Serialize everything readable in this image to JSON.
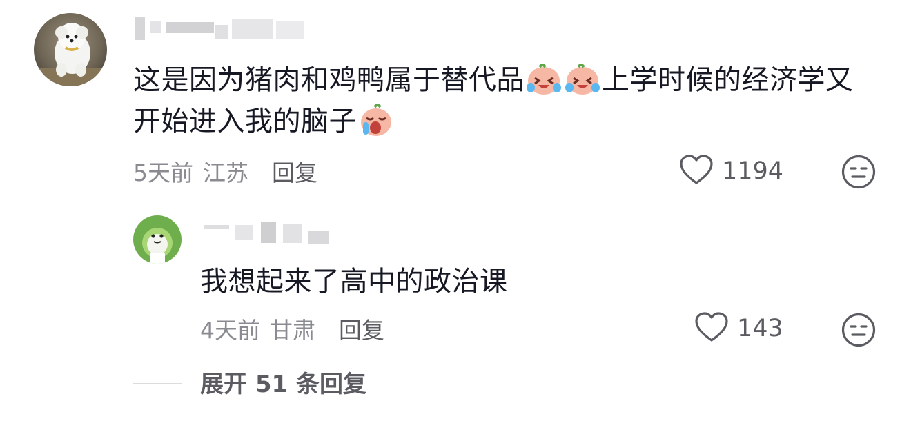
{
  "comment": {
    "text_part1": "这是因为猪肉和鸡鸭属于替代品",
    "text_part2": "上学时候的经济学又开始进入我的脑子",
    "time": "5天前",
    "location": "江苏",
    "reply_label": "回复",
    "like_count": "1194"
  },
  "sub_comment": {
    "text": "我想起来了高中的政治课",
    "time": "4天前",
    "location": "甘肃",
    "reply_label": "回复",
    "like_count": "143"
  },
  "expand": {
    "label": "展开 51 条回复"
  },
  "icons": {
    "heart": "heart-outline-icon",
    "dislike": "meh-face-icon",
    "emoji_laugh_cry": "laugh-cry-emoji",
    "emoji_cry": "loud-cry-emoji"
  }
}
